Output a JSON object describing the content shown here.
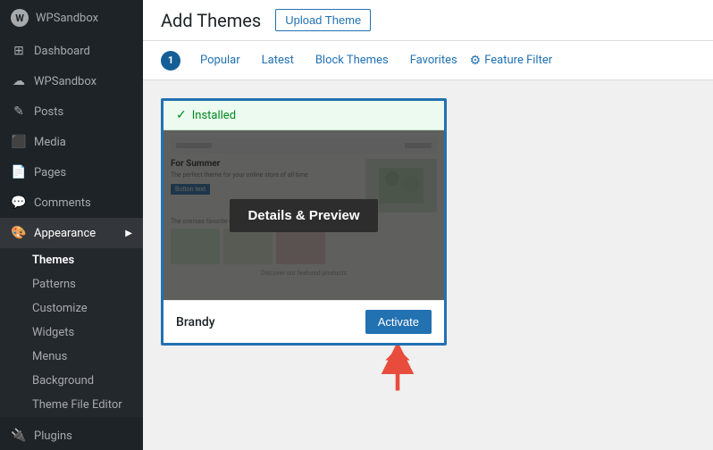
{
  "sidebar": {
    "site_name": "WPSandbox",
    "items": [
      {
        "id": "dashboard",
        "label": "Dashboard",
        "icon": "⊞"
      },
      {
        "id": "wpSandbox",
        "label": "WPSandbox",
        "icon": "☁"
      },
      {
        "id": "posts",
        "label": "Posts",
        "icon": "✎"
      },
      {
        "id": "media",
        "label": "Media",
        "icon": "⬛"
      },
      {
        "id": "pages",
        "label": "Pages",
        "icon": "📄"
      },
      {
        "id": "comments",
        "label": "Comments",
        "icon": "💬"
      },
      {
        "id": "appearance",
        "label": "Appearance",
        "icon": "🎨"
      },
      {
        "id": "plugins",
        "label": "Plugins",
        "icon": "🔌"
      }
    ],
    "appearance_submenu": [
      {
        "id": "themes",
        "label": "Themes",
        "active": true
      },
      {
        "id": "patterns",
        "label": "Patterns"
      },
      {
        "id": "customize",
        "label": "Customize"
      },
      {
        "id": "widgets",
        "label": "Widgets"
      },
      {
        "id": "menus",
        "label": "Menus"
      },
      {
        "id": "background",
        "label": "Background"
      },
      {
        "id": "theme-file-editor",
        "label": "Theme File Editor"
      }
    ]
  },
  "header": {
    "title": "Add Themes",
    "upload_button": "Upload Theme"
  },
  "tabs": {
    "count": "1",
    "items": [
      {
        "id": "popular",
        "label": "Popular"
      },
      {
        "id": "latest",
        "label": "Latest"
      },
      {
        "id": "block-themes",
        "label": "Block Themes"
      },
      {
        "id": "favorites",
        "label": "Favorites"
      },
      {
        "id": "feature-filter",
        "label": "Feature Filter"
      }
    ]
  },
  "theme_card": {
    "installed_label": "Installed",
    "preview_title": "For Summer",
    "preview_desc": "The perfect theme for your online store",
    "overlay_label": "Details & Preview",
    "footer_text": "Discover our featured products",
    "theme_name": "Brandy",
    "activate_label": "Activate"
  }
}
